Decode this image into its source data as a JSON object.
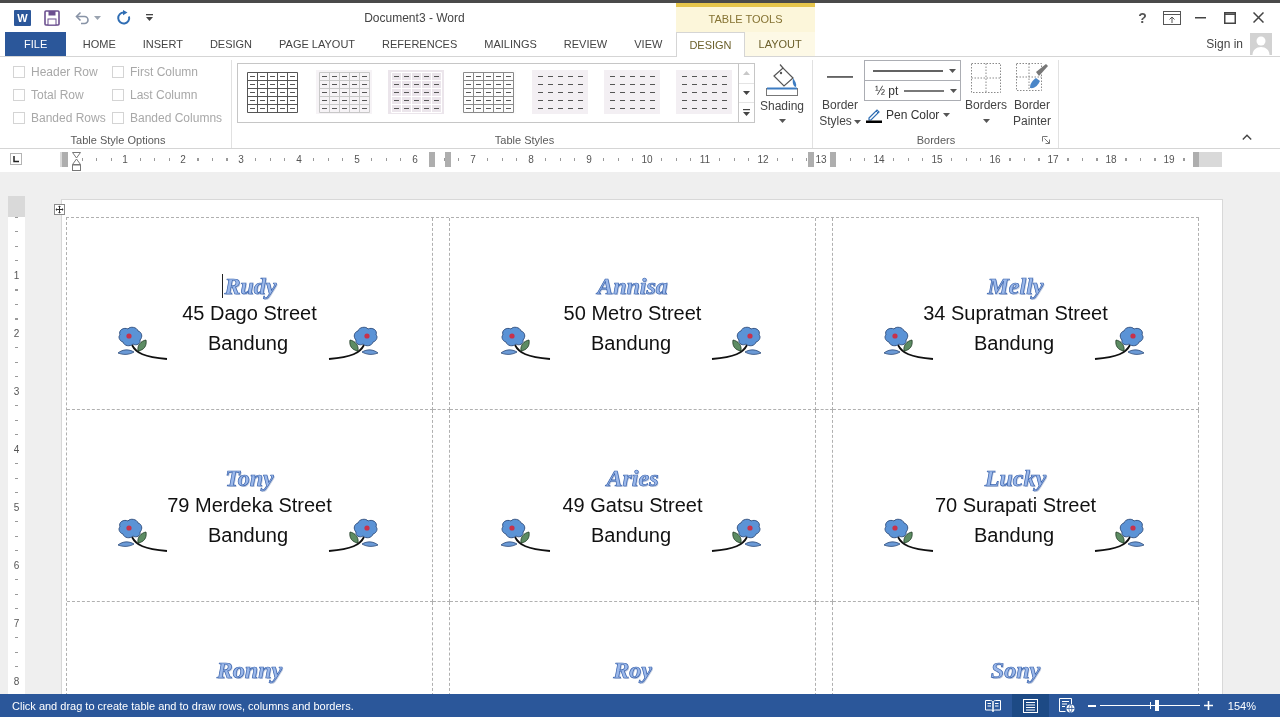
{
  "window": {
    "app_letter": "W",
    "title": "Document3 - Word",
    "help": "?"
  },
  "contextual_group": {
    "label": "TABLE TOOLS"
  },
  "tabs": [
    {
      "label": "FILE",
      "kind": "file",
      "selected": false
    },
    {
      "label": "HOME",
      "kind": "standard",
      "selected": false
    },
    {
      "label": "INSERT",
      "kind": "standard",
      "selected": false
    },
    {
      "label": "DESIGN",
      "kind": "standard",
      "selected": false
    },
    {
      "label": "PAGE LAYOUT",
      "kind": "standard",
      "selected": false
    },
    {
      "label": "REFERENCES",
      "kind": "standard",
      "selected": false
    },
    {
      "label": "MAILINGS",
      "kind": "standard",
      "selected": false
    },
    {
      "label": "REVIEW",
      "kind": "standard",
      "selected": false
    },
    {
      "label": "VIEW",
      "kind": "standard",
      "selected": false
    },
    {
      "label": "DESIGN",
      "kind": "contextual",
      "selected": true
    },
    {
      "label": "LAYOUT",
      "kind": "contextual",
      "selected": false
    }
  ],
  "account": {
    "label": "Sign in"
  },
  "ribbon": {
    "table_style_options": {
      "label": "Table Style Options",
      "options": [
        {
          "label": "Header Row",
          "checked": false,
          "disabled": true
        },
        {
          "label": "First Column",
          "checked": false,
          "disabled": true
        },
        {
          "label": "Total Row",
          "checked": false,
          "disabled": true
        },
        {
          "label": "Last Column",
          "checked": false,
          "disabled": true
        },
        {
          "label": "Banded Rows",
          "checked": false,
          "disabled": true
        },
        {
          "label": "Banded Columns",
          "checked": false,
          "disabled": true
        }
      ]
    },
    "table_styles": {
      "label": "Table Styles",
      "styles": [
        {
          "kind": "dark_grid"
        },
        {
          "kind": "light_grid"
        },
        {
          "kind": "shaded_grid"
        },
        {
          "kind": "medium_grid"
        },
        {
          "kind": "plain"
        },
        {
          "kind": "plain"
        },
        {
          "kind": "plain"
        }
      ],
      "shading": {
        "label": "Shading"
      }
    },
    "borders": {
      "label": "Borders",
      "border_styles": {
        "label": "Border Styles"
      },
      "line_weight": {
        "value": "½ pt"
      },
      "pen_color": {
        "label": "Pen Color"
      },
      "borders_button": {
        "label": "Borders"
      },
      "border_painter": {
        "label": "Border Painter"
      }
    }
  },
  "rulers": {
    "horizontal": [
      "1",
      "2",
      "3",
      "4",
      "5",
      "6",
      "7",
      "8",
      "9",
      "10",
      "11",
      "12",
      "13",
      "14",
      "15",
      "16",
      "17",
      "18",
      "19"
    ],
    "vertical": [
      "1",
      "2",
      "3",
      "4",
      "5",
      "6",
      "7",
      "8"
    ]
  },
  "labels": [
    {
      "name": "Rudy",
      "address": [
        "45 Dago Street",
        "Bandung"
      ],
      "text_cursor": true
    },
    {
      "name": "Annisa",
      "address": [
        "50 Metro Street",
        "Bandung"
      ],
      "text_cursor": false
    },
    {
      "name": "Melly",
      "address": [
        "34 Supratman Street",
        "Bandung"
      ],
      "text_cursor": false
    },
    {
      "name": "Tony",
      "address": [
        "79 Merdeka Street",
        "Bandung"
      ],
      "text_cursor": false
    },
    {
      "name": "Aries",
      "address": [
        "49 Gatsu Street",
        "Bandung"
      ],
      "text_cursor": false
    },
    {
      "name": "Lucky",
      "address": [
        "70 Surapati Street",
        "Bandung"
      ],
      "text_cursor": false
    },
    {
      "name": "Ronny",
      "text_cursor": false
    },
    {
      "name": "Roy",
      "text_cursor": false
    },
    {
      "name": "Sony",
      "text_cursor": false
    }
  ],
  "status_bar": {
    "message": "Click and drag to create table and to draw rows, columns and borders.",
    "views": [
      {
        "kind": "read",
        "selected": false
      },
      {
        "kind": "print",
        "selected": true
      },
      {
        "kind": "web",
        "selected": false
      }
    ],
    "zoom": {
      "level": 0.57,
      "reading": "154%"
    }
  }
}
